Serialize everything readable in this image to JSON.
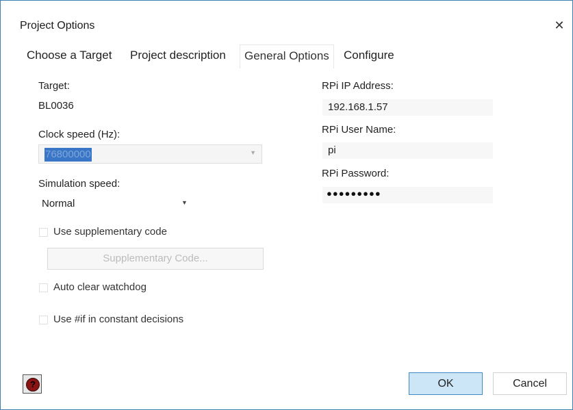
{
  "window": {
    "title": "Project Options"
  },
  "tabs": [
    {
      "label": "Choose a Target"
    },
    {
      "label": "Project description"
    },
    {
      "label": "General Options"
    },
    {
      "label": "Configure"
    }
  ],
  "general": {
    "target_label": "Target:",
    "target_value": "BL0036",
    "clock_label": "Clock speed (Hz):",
    "clock_value": "76800000",
    "sim_label": "Simulation speed:",
    "sim_value": "Normal",
    "use_supp_label": "Use supplementary code",
    "supp_button": "Supplementary Code...",
    "auto_clear_label": "Auto clear watchdog",
    "use_if_label": "Use #if in constant decisions"
  },
  "rpi": {
    "ip_label": "RPi IP Address:",
    "ip_value": "192.168.1.57",
    "user_label": "RPi User Name:",
    "user_value": "pi",
    "password_label": "RPi Password:",
    "password_mask": "●●●●●●●●●"
  },
  "footer": {
    "help_glyph": "?",
    "ok_label": "OK",
    "cancel_label": "Cancel"
  },
  "icons": {
    "close": "close-icon",
    "dropdown": "chevron-down-icon",
    "help": "help-icon"
  },
  "colors": {
    "accent": "#3c7fb1",
    "selection": "#3a76c7",
    "ok_fill": "#cde6f7",
    "help_red": "#8a1414"
  }
}
